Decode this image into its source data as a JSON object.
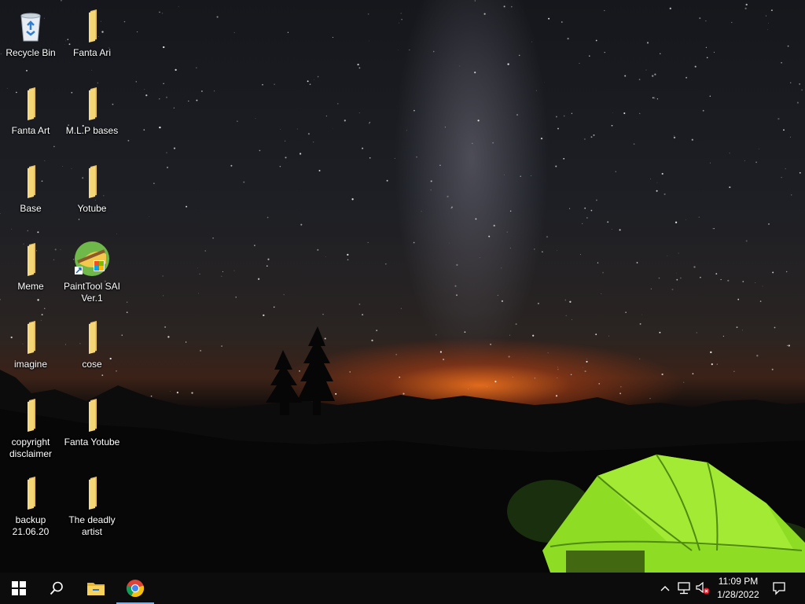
{
  "desktop": {
    "icons": [
      {
        "label": "Recycle Bin",
        "icon": "recycle-bin-icon"
      },
      {
        "label": "Fanta Ari",
        "icon": "folder-icon"
      },
      {
        "label": "Fanta Art",
        "icon": "folder-icon"
      },
      {
        "label": "M.L.P bases",
        "icon": "folder-icon"
      },
      {
        "label": "Base",
        "icon": "folder-icon"
      },
      {
        "label": "Yotube",
        "icon": "folder-icon"
      },
      {
        "label": "Meme",
        "icon": "folder-icon"
      },
      {
        "label": "PaintTool SAI Ver.1",
        "icon": "painttool-sai-icon"
      },
      {
        "label": "imagine",
        "icon": "folder-icon"
      },
      {
        "label": "cose",
        "icon": "folder-icon"
      },
      {
        "label": "copyright disclaimer",
        "icon": "folder-icon"
      },
      {
        "label": "Fanta Yotube",
        "icon": "folder-icon"
      },
      {
        "label": "backup 21.06.20",
        "icon": "folder-icon"
      },
      {
        "label": "The deadly artist",
        "icon": "folder-icon"
      }
    ]
  },
  "taskbar": {
    "pinned": [
      {
        "name": "start-button",
        "icon": "windows-logo-icon"
      },
      {
        "name": "search-button",
        "icon": "search-icon"
      },
      {
        "name": "file-explorer-button",
        "icon": "file-explorer-icon"
      },
      {
        "name": "chrome-button",
        "icon": "chrome-icon",
        "active": true
      }
    ],
    "tray": {
      "icons": [
        "chevron-up-icon",
        "network-icon",
        "volume-muted-icon",
        "notification-icon"
      ],
      "time": "11:09 PM",
      "date": "1/28/2022"
    }
  },
  "colors": {
    "taskbar": "#0c0c0c",
    "folder": "#f6d77a",
    "tent": "#9be52d",
    "active_indicator": "#7fb0e0"
  }
}
